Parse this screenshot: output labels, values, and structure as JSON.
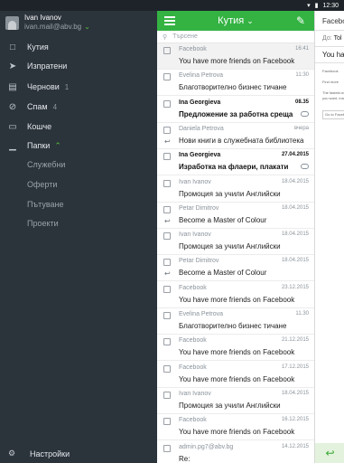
{
  "status": {
    "time": "12:30"
  },
  "account": {
    "name": "Ivan Ivanov",
    "email": "ivan.mail@abv.bg"
  },
  "nav": [
    {
      "label": "Кутия",
      "count": "",
      "icon": "inbox-icon"
    },
    {
      "label": "Изпратени",
      "count": "",
      "icon": "send-icon"
    },
    {
      "label": "Чернови",
      "count": "1",
      "icon": "drafts-icon"
    },
    {
      "label": "Спам",
      "count": "4",
      "icon": "spam-icon"
    },
    {
      "label": "Кошче",
      "count": "",
      "icon": "trash-icon"
    },
    {
      "label": "Папки",
      "count": "",
      "icon": "folder-icon"
    }
  ],
  "folders": [
    "Служебни",
    "Оферти",
    "Пътуване",
    "Проекти"
  ],
  "settings_label": "Настройки",
  "list": {
    "title": "Кутия",
    "search_placeholder": "Търсене",
    "messages": [
      {
        "sender": "Facebook",
        "date": "16:41",
        "subject": "You have more friends on Facebook",
        "unread": false,
        "reply": false,
        "badge": false
      },
      {
        "sender": "Evelina Petrova",
        "date": "11:30",
        "subject": "Благотворително бизнес тичане",
        "unread": false,
        "reply": false,
        "badge": false
      },
      {
        "sender": "Ina Georgieva",
        "date": "08.35",
        "subject": "Предложение за работна среща",
        "unread": true,
        "reply": false,
        "badge": true
      },
      {
        "sender": "Daniela Petrova",
        "date": "вчера",
        "subject": "Нови книги в служебната библиотека",
        "unread": false,
        "reply": true,
        "badge": false
      },
      {
        "sender": "Ina Georgieva",
        "date": "27.04.2015",
        "subject": "Изработка на флаери, плакати",
        "unread": true,
        "reply": false,
        "badge": true
      },
      {
        "sender": "Ivan Ivanov",
        "date": "18.04.2015",
        "subject": "Промоция за учили Английски",
        "unread": false,
        "reply": false,
        "badge": false
      },
      {
        "sender": "Petar Dimitrov",
        "date": "18.04.2015",
        "subject": "Become a Master of Colour",
        "unread": false,
        "reply": true,
        "badge": false
      },
      {
        "sender": "Ivan Ivanov",
        "date": "18.04.2015",
        "subject": "Промоция за учили Английски",
        "unread": false,
        "reply": false,
        "badge": false
      },
      {
        "sender": "Petar Dimitrov",
        "date": "18.04.2015",
        "subject": "Become a Master of Colour",
        "unread": false,
        "reply": true,
        "badge": false
      },
      {
        "sender": "Facebook",
        "date": "23.12.2015",
        "subject": "You have more friends on Facebook",
        "unread": false,
        "reply": false,
        "badge": false
      },
      {
        "sender": "Evelina Petrova",
        "date": "11.30",
        "subject": "Благотворително бизнес тичане",
        "unread": false,
        "reply": false,
        "badge": false
      },
      {
        "sender": "Facebook",
        "date": "21.12.2015",
        "subject": "You have more friends on Facebook",
        "unread": false,
        "reply": false,
        "badge": false
      },
      {
        "sender": "Facebook",
        "date": "17.12.2015",
        "subject": "You have more friends on Facebook",
        "unread": false,
        "reply": false,
        "badge": false
      },
      {
        "sender": "Ivan Ivanov",
        "date": "18.04.2015",
        "subject": "Промоция за учили Английски",
        "unread": false,
        "reply": false,
        "badge": false
      },
      {
        "sender": "Facebook",
        "date": "16.12.2015",
        "subject": "You have more friends on Facebook",
        "unread": false,
        "reply": false,
        "badge": false
      },
      {
        "sender": "admin.pg7@abv.bg",
        "date": "14.12.2015",
        "subject": "Re:",
        "unread": false,
        "reply": false,
        "badge": false
      }
    ]
  },
  "compose": {
    "from": "Facebo",
    "to_label": "До:",
    "to_value": "Tol",
    "subject": "You ha",
    "body_sender": "Facebook",
    "body_line1": "Find more",
    "body_line2": "The fastest way",
    "body_line3": "you want, manage",
    "body_button": "Go to Facebook"
  },
  "colors": {
    "accent": "#34b343",
    "sidebar": "#2b333b"
  }
}
